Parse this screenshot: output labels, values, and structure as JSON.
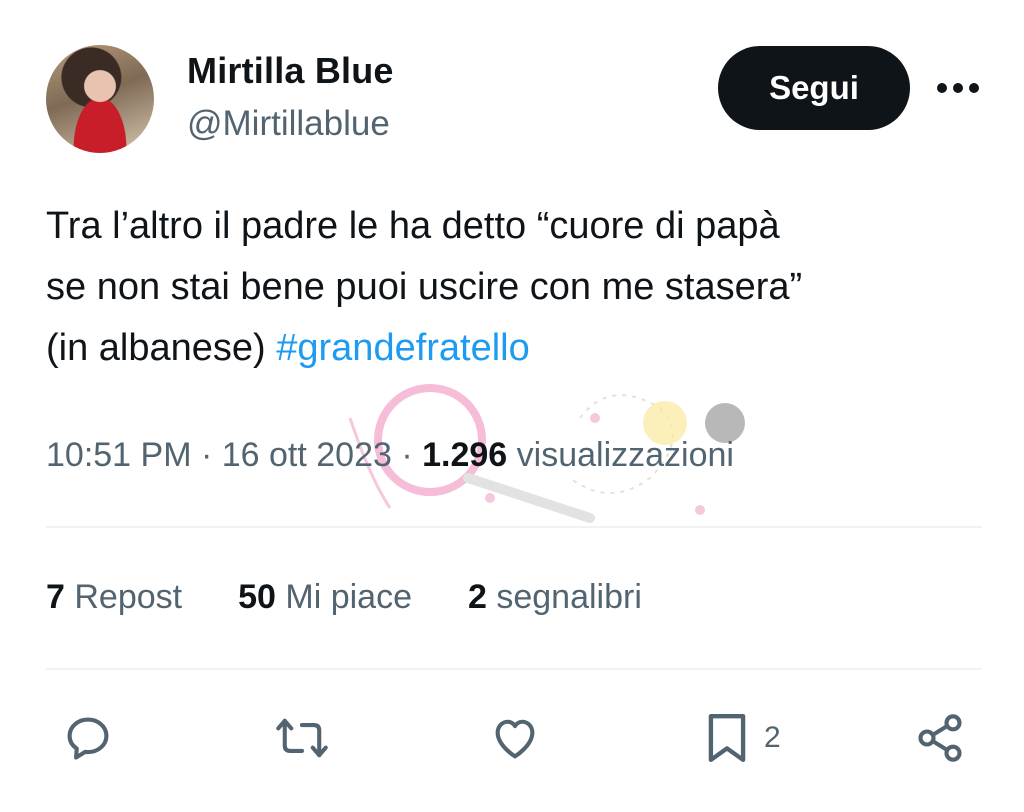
{
  "author": {
    "name": "Mirtilla Blue",
    "handle": "@Mirtillablue"
  },
  "header": {
    "follow_label": "Segui",
    "more_icon": "more-horizontal-icon"
  },
  "tweet": {
    "text": "Tra l’altro  il padre le ha detto “cuore di papà\nse non stai bene puoi uscire con me stasera”\n (in albanese) ",
    "hashtag": "#grandefratello"
  },
  "meta": {
    "time": "10:51 PM",
    "separator1": " · ",
    "date": "16 ott 2023",
    "separator2": " · ",
    "views_count": "1.296",
    "views_label": " visualizzazioni"
  },
  "stats": {
    "reposts_count": "7",
    "reposts_label": " Repost",
    "likes_count": "50",
    "likes_label": " Mi piace",
    "bookmarks_count": "2",
    "bookmarks_label": " segnalibri"
  },
  "actions": {
    "reply_icon": "reply-icon",
    "repost_icon": "repost-icon",
    "like_icon": "heart-icon",
    "bookmark_icon": "bookmark-icon",
    "bookmark_count": "2",
    "share_icon": "share-icon"
  },
  "colors": {
    "text": "#0f1419",
    "secondary": "#536471",
    "link": "#1d9bf0",
    "button_bg": "#0f1419",
    "divider": "#eff3f4"
  }
}
